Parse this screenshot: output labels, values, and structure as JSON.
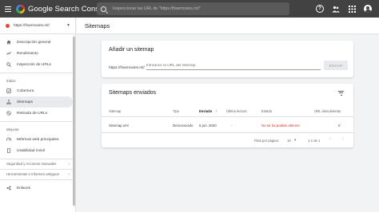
{
  "topbar": {
    "brand": "Google Search Console",
    "search_placeholder": "Inspeccionar las URL de \"https://fowmovies.ml/\"",
    "icons": [
      "menu-icon",
      "search-icon",
      "help-icon",
      "people-icon",
      "apps-icon",
      "avatar-icon"
    ]
  },
  "sidebar": {
    "property": "https://fowmovies.ml/",
    "items_top": [
      {
        "label": "Descripción general",
        "icon": "home-icon"
      },
      {
        "label": "Rendimiento",
        "icon": "trending-icon"
      },
      {
        "label": "Inspección de URLs",
        "icon": "search-icon"
      }
    ],
    "index_header": "Índice",
    "items_index": [
      {
        "label": "Cobertura",
        "icon": "coverage-icon"
      },
      {
        "label": "Sitemaps",
        "icon": "sitemap-icon"
      },
      {
        "label": "Retirada de URLs",
        "icon": "removal-icon"
      }
    ],
    "improvements_header": "Mejoras",
    "items_improvements": [
      {
        "label": "Métricas web principales",
        "icon": "speed-icon"
      },
      {
        "label": "Usabilidad móvil",
        "icon": "phone-icon"
      }
    ],
    "security_header": "Seguridad y Acciones manuales",
    "legacy_header": "Herramientas e informes antiguos",
    "links_label": "Enlaces"
  },
  "main": {
    "page_title": "Sitemaps",
    "add_card": {
      "title": "Añadir un sitemap",
      "prefix": "https://fowmovies.ml/",
      "placeholder": "Introduce la URL del sitemap",
      "send_label": "ENVIAR"
    },
    "sent_card": {
      "title": "Sitemaps enviados",
      "columns": [
        "Sitemap",
        "Tipo",
        "Enviado",
        "Última lectura",
        "Estado",
        "URL descubiertas"
      ],
      "rows": [
        {
          "sitemap": "/sitemap.xml",
          "tipo": "Desconocido",
          "enviado": "5 jun. 2020",
          "ultima": "-",
          "estado": "No se ha podido obtener",
          "urls": "0"
        }
      ],
      "pager": {
        "rows_per_page_label": "Filas por página:",
        "rows_per_page": "10",
        "range": "1-1 de 1"
      }
    }
  },
  "colors": {
    "topbar_bg": "#424242",
    "error_red": "#d93025",
    "active_item_bg": "#e8eaed"
  }
}
